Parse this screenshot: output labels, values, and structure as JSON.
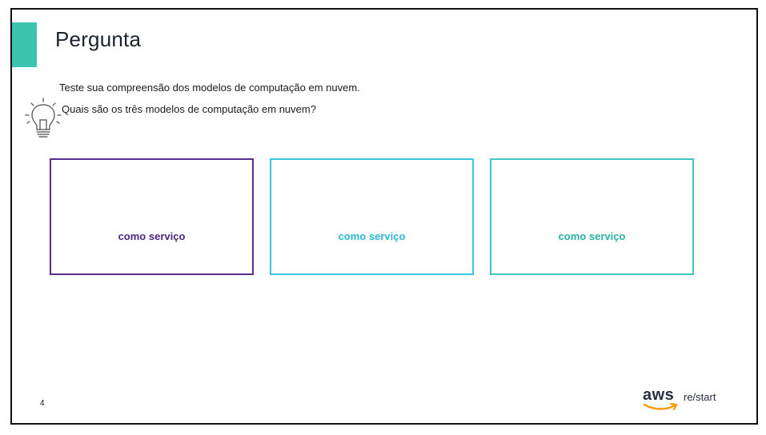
{
  "slide": {
    "title": "Pergunta",
    "intro": "Teste sua compreensão dos modelos de computação em nuvem.",
    "question": "Quais são os três modelos de computação em nuvem?",
    "page_number": "4"
  },
  "cards": [
    {
      "label": "como serviço",
      "color": "#5a2d8e"
    },
    {
      "label": "como serviço",
      "color": "#3bc7e0"
    },
    {
      "label": "como serviço",
      "color": "#3dc7be"
    }
  ],
  "logo": {
    "brand": "aws",
    "product": "re/start"
  },
  "colors": {
    "accent": "#3cc4b0",
    "border": "#111111",
    "aws_orange": "#ff9900"
  },
  "icons": [
    "lightbulb-icon",
    "aws-smile-icon"
  ]
}
